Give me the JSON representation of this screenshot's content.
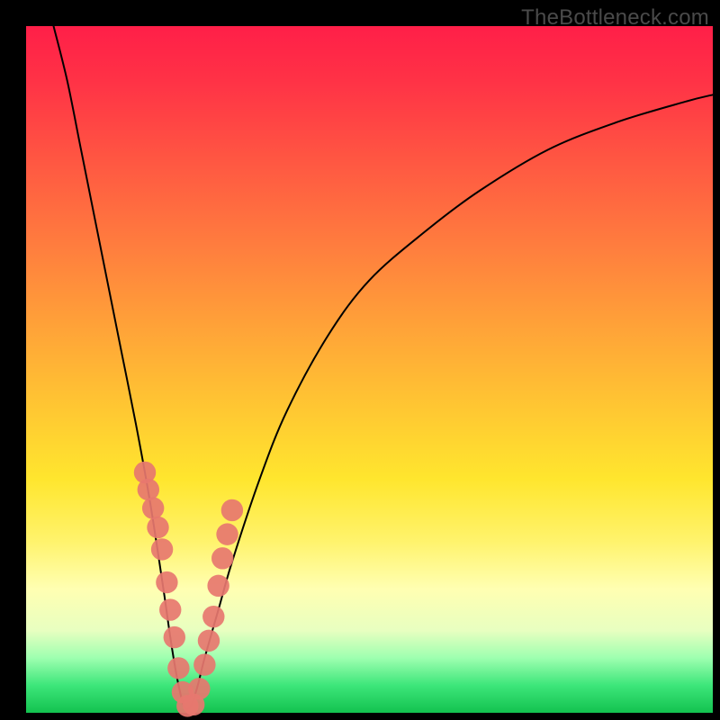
{
  "watermark": "TheBottleneck.com",
  "colors": {
    "frame": "#000000",
    "curve_stroke": "#000000",
    "bead_fill": "#e7776f",
    "gradient_top": "#ff1f48",
    "gradient_bottom": "#13c24f"
  },
  "chart_data": {
    "type": "line",
    "title": "",
    "xlabel": "",
    "ylabel": "",
    "xlim": [
      0,
      100
    ],
    "ylim": [
      0,
      100
    ],
    "grid": false,
    "legend": false,
    "note": "Values are read as percentages of the plot area; curve is a V-shaped dip reaching ~0 near x≈23 with an asymmetric rise.",
    "series": [
      {
        "name": "curve",
        "x": [
          4,
          6,
          8,
          10,
          12,
          14,
          16,
          18,
          20,
          21,
          22,
          23,
          24,
          25,
          26,
          28,
          30,
          34,
          38,
          44,
          50,
          58,
          66,
          76,
          86,
          96,
          100
        ],
        "y": [
          100,
          92,
          82,
          72,
          62,
          52,
          42,
          31,
          18,
          11,
          5,
          1,
          1,
          4,
          8,
          15,
          22,
          34,
          44,
          55,
          63,
          70,
          76,
          82,
          86,
          89,
          90
        ]
      }
    ],
    "markers": {
      "name": "beads",
      "note": "Salmon-colored dots overlaid on the curve near the V bottom.",
      "x": [
        17.3,
        17.8,
        18.5,
        19.2,
        19.8,
        20.5,
        21.0,
        21.6,
        22.2,
        22.8,
        23.5,
        24.4,
        25.2,
        26.0,
        26.6,
        27.3,
        28.0,
        28.6,
        29.3,
        30.0
      ],
      "y": [
        35.0,
        32.5,
        29.8,
        27.0,
        23.8,
        19.0,
        15.0,
        11.0,
        6.5,
        3.0,
        1.0,
        1.2,
        3.5,
        7.0,
        10.5,
        14.0,
        18.5,
        22.5,
        26.0,
        29.5
      ],
      "r": 1.6
    }
  }
}
